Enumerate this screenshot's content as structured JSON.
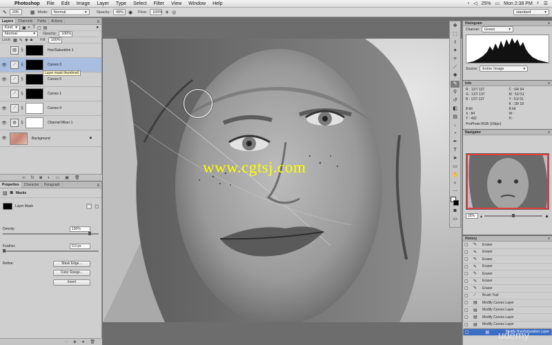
{
  "menubar": {
    "app": "Photoshop",
    "items": [
      "File",
      "Edit",
      "Image",
      "Layer",
      "Type",
      "Select",
      "Filter",
      "View",
      "Window",
      "Help"
    ],
    "battery": "25%",
    "clock": "Mon 2:38 PM"
  },
  "options": {
    "brush_size": "205",
    "mode_label": "Mode:",
    "mode_value": "Normal",
    "opacity_label": "Opacity:",
    "opacity_value": "49%",
    "flow_label": "Flow:",
    "flow_value": "100%",
    "workspace": "standard"
  },
  "layers_panel": {
    "tabs": [
      "Layers",
      "Channels",
      "Paths",
      "Actions"
    ],
    "filter_kind": "Kind",
    "blend_mode": "Normal",
    "opacity_label": "Opacity:",
    "opacity_value": "100%",
    "lock_label": "Lock:",
    "fill_label": "Fill:",
    "fill_value": "100%",
    "tooltip": "Layer mask thumbnail",
    "layers": [
      {
        "name": "Hue/Saturation 1"
      },
      {
        "name": "Curves 3"
      },
      {
        "name": "Curves 5"
      },
      {
        "name": "Curves 1"
      },
      {
        "name": "Curves 4"
      },
      {
        "name": "Channel Mixer 1"
      },
      {
        "name": "Background"
      }
    ]
  },
  "properties_panel": {
    "tabs": [
      "Properties",
      "Character",
      "Paragraph"
    ],
    "masks_label": "Masks",
    "layer_mask_label": "Layer Mask",
    "density_label": "Density:",
    "density_value": "100%",
    "feather_label": "Feather:",
    "feather_value": "0.0 px",
    "refine_label": "Refine:",
    "mask_edge_button": "Mask Edge...",
    "color_range_button": "Color Range...",
    "invert_button": "Invert"
  },
  "canvas": {
    "watermark": "www.cgtsj.com"
  },
  "histogram_panel": {
    "title": "Histogram",
    "channel_label": "Channel:",
    "channel_value": "Green",
    "source_label": "Source:",
    "source_value": "Entire Image"
  },
  "info_panel": {
    "title": "Info",
    "rows": [
      {
        "left": "R :   137/ 137",
        "right": "C :    64/ 64"
      },
      {
        "left": "G :   137/ 137",
        "right": "M :    51/ 51"
      },
      {
        "left": "B :   137/ 137",
        "right": "Y :    51/ 51"
      },
      {
        "left": "",
        "right": "K :    18/ 18"
      },
      {
        "left": "8-bit",
        "right": "8-bit"
      },
      {
        "left": "X :     84",
        "right": "W :"
      },
      {
        "left": "Y :    492",
        "right": "H :"
      }
    ],
    "profile": "ProPhoto RGB (16bpc)"
  },
  "navigator_panel": {
    "title": "Navigator",
    "zoom": "25%"
  },
  "history_panel": {
    "title": "History",
    "items": [
      {
        "icon": "brush",
        "label": "Eraser"
      },
      {
        "icon": "brush",
        "label": "Eraser"
      },
      {
        "icon": "brush",
        "label": "Eraser"
      },
      {
        "icon": "brush",
        "label": "Eraser"
      },
      {
        "icon": "brush",
        "label": "Eraser"
      },
      {
        "icon": "brush",
        "label": "Eraser"
      },
      {
        "icon": "brush",
        "label": "Eraser"
      },
      {
        "icon": "brush",
        "label": "Brush Tool"
      },
      {
        "icon": "layer",
        "label": "Modify Curves Layer"
      },
      {
        "icon": "layer",
        "label": "Modify Curves Layer"
      },
      {
        "icon": "layer",
        "label": "Modify Curves Layer"
      },
      {
        "icon": "layer",
        "label": "Modify Curves Layer"
      },
      {
        "icon": "layer",
        "label": "Modify Hue/Saturation Layer"
      }
    ]
  },
  "udemy_watermark": "udemy"
}
